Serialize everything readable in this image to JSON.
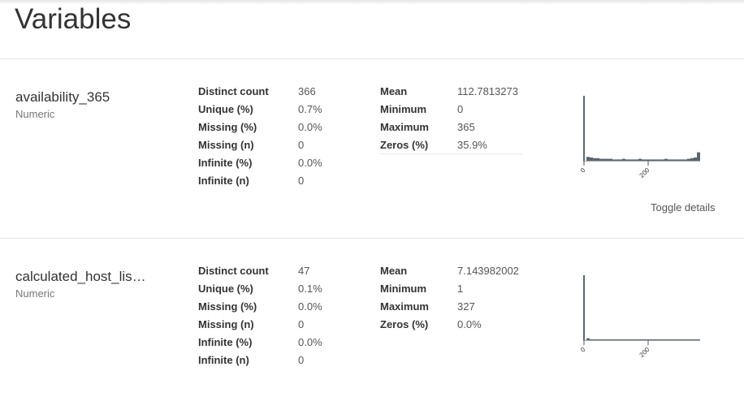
{
  "page": {
    "title": "Variables"
  },
  "variables": [
    {
      "name": "availability_365",
      "type": "Numeric",
      "stats_left": [
        {
          "label": "Distinct count",
          "value": "366"
        },
        {
          "label": "Unique (%)",
          "value": "0.7%"
        },
        {
          "label": "Missing (%)",
          "value": "0.0%"
        },
        {
          "label": "Missing (n)",
          "value": "0"
        },
        {
          "label": "Infinite (%)",
          "value": "0.0%"
        },
        {
          "label": "Infinite (n)",
          "value": "0"
        }
      ],
      "stats_right": [
        {
          "label": "Mean",
          "value": "112.7813273"
        },
        {
          "label": "Minimum",
          "value": "0"
        },
        {
          "label": "Maximum",
          "value": "365"
        },
        {
          "label": "Zeros (%)",
          "value": "35.9%"
        }
      ],
      "histogram": {
        "x_ticks": [
          "0",
          "200"
        ],
        "bars": [
          1.0,
          0.06,
          0.05,
          0.04,
          0.04,
          0.03,
          0.03,
          0.03,
          0.03,
          0.02,
          0.02,
          0.02,
          0.03,
          0.02,
          0.02,
          0.02,
          0.02,
          0.03,
          0.02,
          0.02,
          0.02,
          0.02,
          0.02,
          0.02,
          0.02,
          0.03,
          0.02,
          0.02,
          0.02,
          0.02,
          0.02,
          0.02,
          0.03,
          0.04,
          0.05,
          0.13
        ]
      },
      "toggle_label": "Toggle details"
    },
    {
      "name": "calculated_host_lis…",
      "type": "Numeric",
      "stats_left": [
        {
          "label": "Distinct count",
          "value": "47"
        },
        {
          "label": "Unique (%)",
          "value": "0.1%"
        },
        {
          "label": "Missing (%)",
          "value": "0.0%"
        },
        {
          "label": "Missing (n)",
          "value": "0"
        },
        {
          "label": "Infinite (%)",
          "value": "0.0%"
        },
        {
          "label": "Infinite (n)",
          "value": "0"
        }
      ],
      "stats_right": [
        {
          "label": "Mean",
          "value": "7.143982002"
        },
        {
          "label": "Minimum",
          "value": "1"
        },
        {
          "label": "Maximum",
          "value": "327"
        },
        {
          "label": "Zeros (%)",
          "value": "0.0%"
        }
      ],
      "histogram": {
        "x_ticks": [
          "0",
          "200"
        ],
        "bars": [
          1.0,
          0.03,
          0.01,
          0.01,
          0.01,
          0.005,
          0.005,
          0.005,
          0.01,
          0.005,
          0.005,
          0.005,
          0.005,
          0.005,
          0.005,
          0.005,
          0.005,
          0.005,
          0.005,
          0.01,
          0.005,
          0.005,
          0.005,
          0.005,
          0.005,
          0.005,
          0.005,
          0.005,
          0.005,
          0.005,
          0.005,
          0.005,
          0.005,
          0.005,
          0.005,
          0.01
        ]
      }
    }
  ],
  "colors": {
    "bar": "#5b6770",
    "axis": "#555555"
  }
}
